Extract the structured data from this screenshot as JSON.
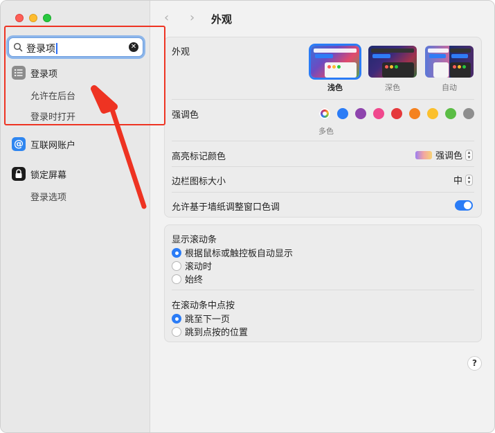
{
  "colors": {
    "accent": "#2b7cf6",
    "annotation": "#ee3322"
  },
  "search": {
    "value": "登录项"
  },
  "sidebar": {
    "items": [
      {
        "label": "登录项",
        "icon": "list-icon",
        "subitems": [
          "允许在后台",
          "登录时打开"
        ]
      },
      {
        "label": "互联网账户",
        "icon": "at-icon"
      },
      {
        "label": "锁定屏幕",
        "icon": "lock-icon",
        "subitems": [
          "登录选项"
        ]
      }
    ]
  },
  "header": {
    "title": "外观"
  },
  "appearance": {
    "label": "外观",
    "options": [
      {
        "label": "浅色",
        "selected": true
      },
      {
        "label": "深色",
        "selected": false
      },
      {
        "label": "自动",
        "selected": false
      }
    ],
    "accent_label": "强调色",
    "accent_caption": "多色",
    "accent_colors": [
      "multicolor",
      "#2b7cf6",
      "#8e44ad",
      "#f0488d",
      "#e5383b",
      "#f5821f",
      "#fbc02d",
      "#5bbd45",
      "#8e8e8e"
    ],
    "highlight_label": "高亮标记颜色",
    "highlight_value": "强调色",
    "sidebar_icon_label": "边栏图标大小",
    "sidebar_icon_value": "中",
    "wallpaper_tint_label": "允许基于墙纸调整窗口色调",
    "wallpaper_tint_on": true
  },
  "scrollbars": {
    "show_label": "显示滚动条",
    "show_options": [
      {
        "label": "根据鼠标或触控板自动显示",
        "selected": true
      },
      {
        "label": "滚动时",
        "selected": false
      },
      {
        "label": "始终",
        "selected": false
      }
    ],
    "click_label": "在滚动条中点按",
    "click_options": [
      {
        "label": "跳至下一页",
        "selected": true
      },
      {
        "label": "跳到点按的位置",
        "selected": false
      }
    ]
  },
  "help": {
    "label": "?"
  }
}
